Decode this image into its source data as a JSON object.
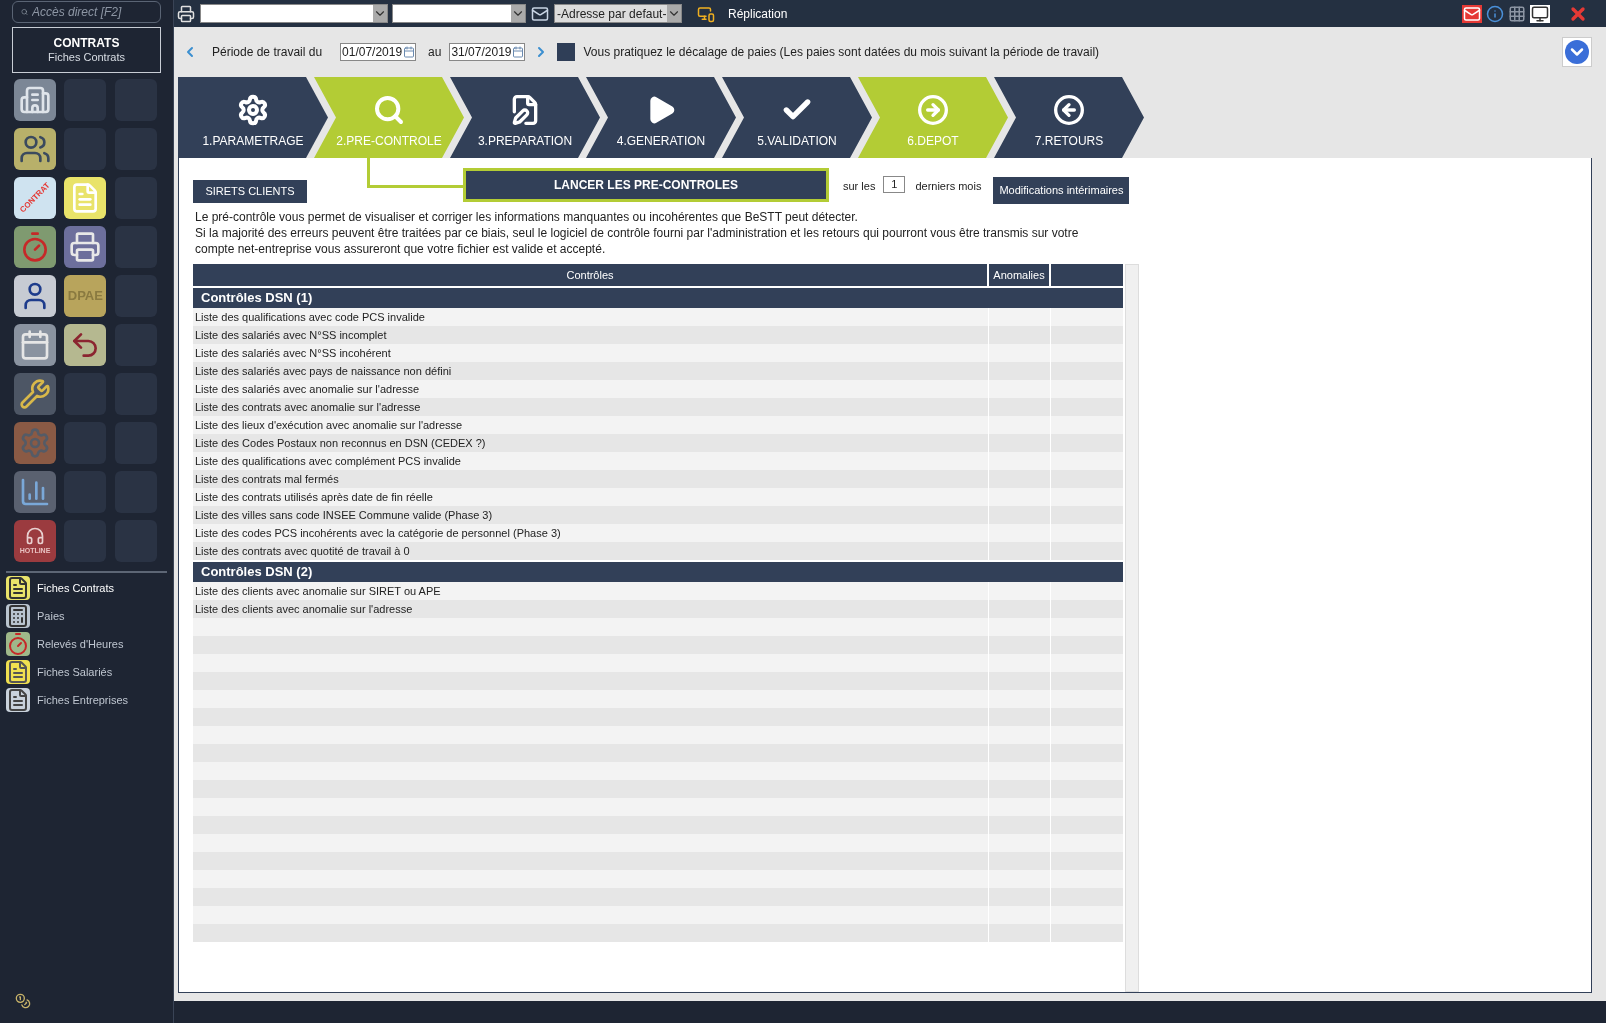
{
  "search": {
    "placeholder": "Accès direct [F2]"
  },
  "module": {
    "title": "CONTRATS",
    "subtitle": "Fiches Contrats"
  },
  "toolbar": {
    "address": "-Adresse par defaut-",
    "replication": "Réplication"
  },
  "tiles": [
    {
      "kind": "building"
    },
    {
      "kind": "empty"
    },
    {
      "kind": "empty"
    },
    {
      "kind": "people"
    },
    {
      "kind": "empty"
    },
    {
      "kind": "empty"
    },
    {
      "kind": "contract",
      "label": "CONTRAT"
    },
    {
      "kind": "folder"
    },
    {
      "kind": "empty"
    },
    {
      "kind": "stopwatch"
    },
    {
      "kind": "printer"
    },
    {
      "kind": "empty"
    },
    {
      "kind": "profile"
    },
    {
      "kind": "text",
      "label": "DPAE"
    },
    {
      "kind": "empty"
    },
    {
      "kind": "calendar"
    },
    {
      "kind": "return"
    },
    {
      "kind": "empty"
    },
    {
      "kind": "tools"
    },
    {
      "kind": "empty"
    },
    {
      "kind": "empty"
    },
    {
      "kind": "gear"
    },
    {
      "kind": "empty"
    },
    {
      "kind": "empty"
    },
    {
      "kind": "chart"
    },
    {
      "kind": "empty"
    },
    {
      "kind": "empty"
    },
    {
      "kind": "hotline",
      "label": "HOTLINE"
    },
    {
      "kind": "empty"
    },
    {
      "kind": "empty"
    }
  ],
  "recent": [
    {
      "label": "Fiches Contrats",
      "kind": "folder",
      "selected": true
    },
    {
      "label": "Paies",
      "kind": "register",
      "selected": false
    },
    {
      "label": "Relevés d'Heures",
      "kind": "stopwatch",
      "selected": false
    },
    {
      "label": "Fiches Salariés",
      "kind": "folder-yellow",
      "selected": false
    },
    {
      "label": "Fiches Entreprises",
      "kind": "folder-grey",
      "selected": false
    }
  ],
  "period": {
    "label": "Période de travail du",
    "from": "01/07/2019",
    "to_label": "au",
    "to": "31/07/2019",
    "shift_checked": false,
    "shift_label": "Vous pratiquez le décalage de paies (Les paies sont datées du mois suivant la période de travail)"
  },
  "steps": [
    {
      "label": "1.PARAMETRAGE",
      "kind": "gear",
      "highlighted": false
    },
    {
      "label": "2.PRE-CONTROLE",
      "kind": "search",
      "highlighted": true
    },
    {
      "label": "3.PREPARATION",
      "kind": "edit",
      "highlighted": false
    },
    {
      "label": "4.GENERATION",
      "kind": "play",
      "highlighted": false
    },
    {
      "label": "5.VALIDATION",
      "kind": "check",
      "highlighted": false
    },
    {
      "label": "6.DEPOT",
      "kind": "arrow-right",
      "highlighted": true
    },
    {
      "label": "7.RETOURS",
      "kind": "arrow-left",
      "highlighted": false
    }
  ],
  "actions": {
    "sirets": "SIRETS CLIENTS",
    "launch": "LANCER LES PRE-CONTROLES",
    "months_prefix": "sur les",
    "months": "1",
    "months_suffix": "derniers mois",
    "interim": "Modifications intérimaires"
  },
  "intro": [
    "Le pré-contrôle vous permet de visualiser et corriger les informations manquantes ou incohérentes que BeSTT peut détecter.",
    "Si la majorité des erreurs peuvent être traitées par ce biais, seul le logiciel de contrôle fourni par l'administration et les retours qui pourront vous être transmis sur votre compte net-entreprise vous assureront que votre fichier est valide et accepté."
  ],
  "table": {
    "columns": [
      "Contrôles",
      "Anomalies"
    ],
    "groups": [
      {
        "title": "Contrôles DSN (1)",
        "rows": [
          "Liste des qualifications avec code PCS invalide",
          "Liste des salariés avec N°SS incomplet",
          "Liste des salariés avec N°SS incohérent",
          "Liste des salariés avec pays de naissance non défini",
          "Liste des salariés avec anomalie sur l'adresse",
          "Liste des contrats avec anomalie sur l'adresse",
          "Liste des lieux d'exécution avec anomalie sur l'adresse",
          "Liste des Codes Postaux non reconnus en DSN (CEDEX ?)",
          "Liste des qualifications avec complément PCS invalide",
          "Liste des contrats mal fermés",
          "Liste des contrats utilisés après date de fin réelle",
          "Liste des villes sans code INSEE Commune valide (Phase 3)",
          "Liste des codes PCS incohérents avec la catégorie de personnel (Phase 3)",
          "Liste des contrats avec quotité de travail à 0"
        ]
      },
      {
        "title": "Contrôles DSN (2)",
        "rows": [
          "Liste des clients avec anomalie sur SIRET ou APE",
          "Liste des clients avec anomalie sur l'adresse"
        ]
      }
    ]
  }
}
